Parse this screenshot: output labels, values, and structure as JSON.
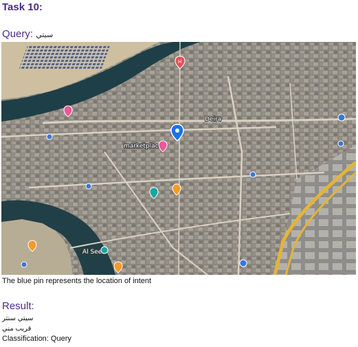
{
  "task": {
    "title": "Task 10:"
  },
  "query": {
    "label": "Query:",
    "text": "سيتي"
  },
  "map": {
    "labels": {
      "deira": "Deira",
      "al_seef": "Al Seef",
      "marketplace": "marketplace"
    },
    "pin_colors": {
      "intent": "#1a73e8",
      "hospital": "#e8505b",
      "shopping": "#e9589a",
      "food": "#f29a2e",
      "attraction": "#18a5a0",
      "transit": "#3a76d8"
    },
    "icons": [
      "intent-pin-icon",
      "hospital-pin-icon",
      "shopping-pin-icon",
      "food-pin-icon",
      "attraction-pin-icon",
      "transit-pin-icon"
    ]
  },
  "caption": "The blue pin represents the location of intent",
  "result": {
    "heading": "Result:",
    "line1": "سيتي سنتر",
    "line2": "قريب مني",
    "classification": "Classification: Query"
  }
}
